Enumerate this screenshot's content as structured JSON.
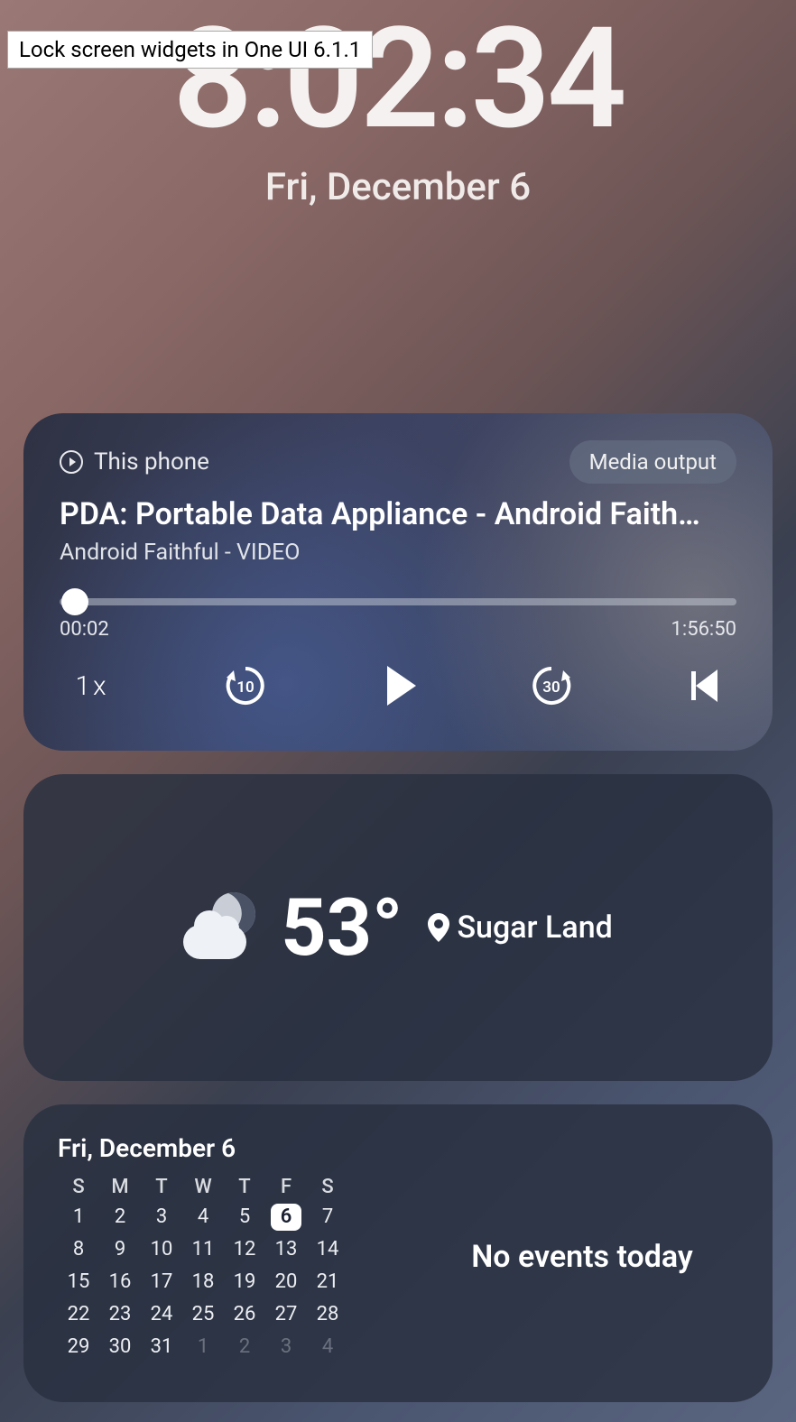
{
  "tooltip": "Lock screen widgets in One UI 6.1.1",
  "clock": {
    "time": "8:02:34",
    "date": "Fri, December 6"
  },
  "media": {
    "source": "This phone",
    "output_button": "Media output",
    "title": "PDA: Portable Data Appliance - Android Faith…",
    "subtitle": "Android Faithful - VIDEO",
    "elapsed": "00:02",
    "duration": "1:56:50",
    "speed": "1x",
    "rewind_seconds": "10",
    "forward_seconds": "30"
  },
  "weather": {
    "temp": "53°",
    "location": "Sugar Land"
  },
  "calendar": {
    "title": "Fri, December 6",
    "dow": [
      "S",
      "M",
      "T",
      "W",
      "T",
      "F",
      "S"
    ],
    "weeks": [
      [
        {
          "n": "1"
        },
        {
          "n": "2"
        },
        {
          "n": "3"
        },
        {
          "n": "4"
        },
        {
          "n": "5"
        },
        {
          "n": "6",
          "today": true
        },
        {
          "n": "7"
        }
      ],
      [
        {
          "n": "8"
        },
        {
          "n": "9"
        },
        {
          "n": "10"
        },
        {
          "n": "11"
        },
        {
          "n": "12"
        },
        {
          "n": "13"
        },
        {
          "n": "14"
        }
      ],
      [
        {
          "n": "15"
        },
        {
          "n": "16"
        },
        {
          "n": "17"
        },
        {
          "n": "18"
        },
        {
          "n": "19"
        },
        {
          "n": "20"
        },
        {
          "n": "21"
        }
      ],
      [
        {
          "n": "22"
        },
        {
          "n": "23"
        },
        {
          "n": "24"
        },
        {
          "n": "25"
        },
        {
          "n": "26"
        },
        {
          "n": "27"
        },
        {
          "n": "28"
        }
      ],
      [
        {
          "n": "29"
        },
        {
          "n": "30"
        },
        {
          "n": "31"
        },
        {
          "n": "1",
          "dim": true
        },
        {
          "n": "2",
          "dim": true
        },
        {
          "n": "3",
          "dim": true
        },
        {
          "n": "4",
          "dim": true
        }
      ]
    ],
    "events_text": "No events today"
  }
}
